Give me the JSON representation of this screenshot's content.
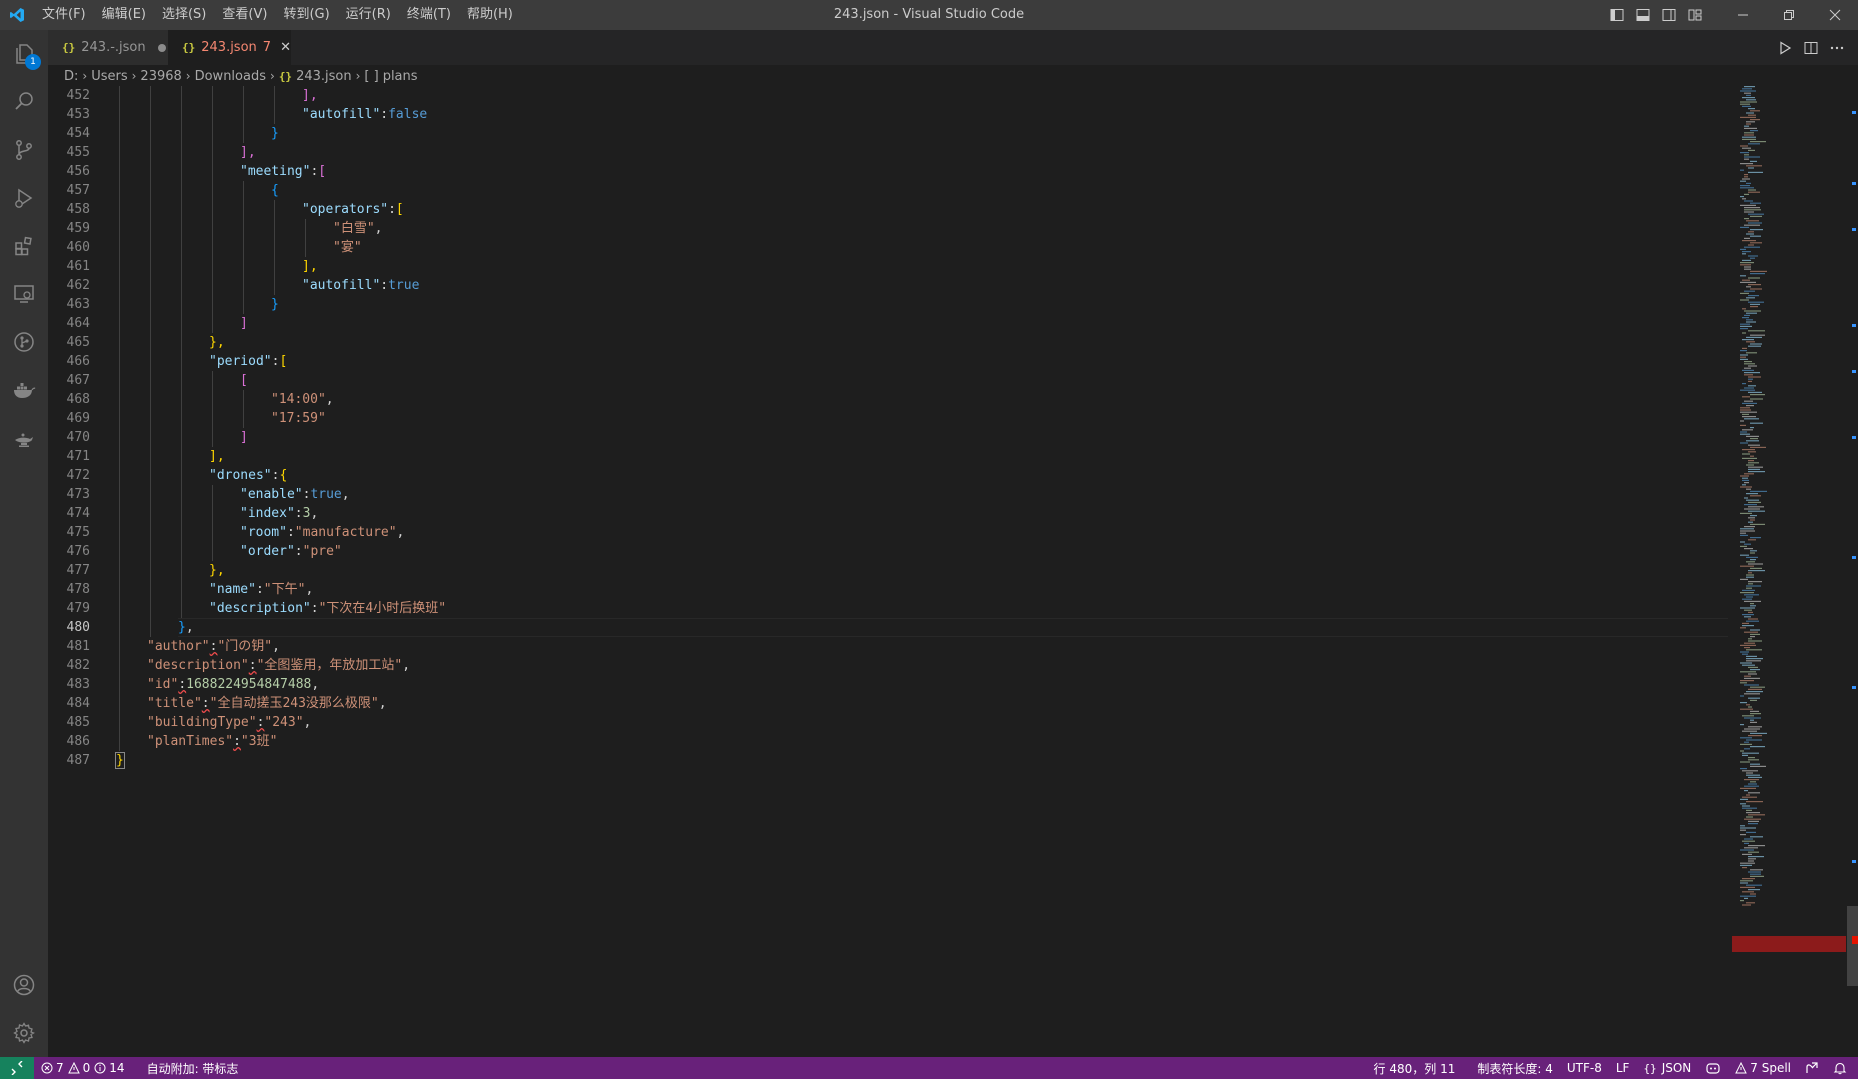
{
  "window": {
    "title": "243.json - Visual Studio Code",
    "menu": [
      "文件(F)",
      "编辑(E)",
      "选择(S)",
      "查看(V)",
      "转到(G)",
      "运行(R)",
      "终端(T)",
      "帮助(H)"
    ]
  },
  "activity_bar": {
    "explorer_badge": "1"
  },
  "tabs": [
    {
      "label": "243.-.json",
      "modified": true
    },
    {
      "label": "243.json",
      "problems": "7",
      "active": true
    }
  ],
  "breadcrumb": [
    "D:",
    "Users",
    "23968",
    "Downloads",
    "243.json",
    "plans"
  ],
  "breadcrumb_last_prefix": "[ ]",
  "editor": {
    "active_line": 480,
    "lines": [
      {
        "n": 452,
        "indent": 6,
        "tokens": [
          [
            "br2",
            "],"
          ]
        ]
      },
      {
        "n": 453,
        "indent": 6,
        "tokens": [
          [
            "k",
            "\"autofill\""
          ],
          [
            "p",
            ":"
          ],
          [
            "b",
            "false"
          ]
        ]
      },
      {
        "n": 454,
        "indent": 5,
        "tokens": [
          [
            "br3",
            "}"
          ]
        ]
      },
      {
        "n": 455,
        "indent": 4,
        "tokens": [
          [
            "br2",
            "],"
          ]
        ]
      },
      {
        "n": 456,
        "indent": 4,
        "tokens": [
          [
            "k",
            "\"meeting\""
          ],
          [
            "p",
            ":"
          ],
          [
            "br2",
            "["
          ]
        ]
      },
      {
        "n": 457,
        "indent": 5,
        "tokens": [
          [
            "br3",
            "{"
          ]
        ]
      },
      {
        "n": 458,
        "indent": 6,
        "tokens": [
          [
            "k",
            "\"operators\""
          ],
          [
            "p",
            ":"
          ],
          [
            "br1",
            "["
          ]
        ]
      },
      {
        "n": 459,
        "indent": 7,
        "tokens": [
          [
            "s",
            "\"白雪\""
          ],
          [
            "p",
            ","
          ]
        ]
      },
      {
        "n": 460,
        "indent": 7,
        "tokens": [
          [
            "s",
            "\"宴\""
          ]
        ]
      },
      {
        "n": 461,
        "indent": 6,
        "tokens": [
          [
            "br1",
            "],"
          ]
        ]
      },
      {
        "n": 462,
        "indent": 6,
        "tokens": [
          [
            "k",
            "\"autofill\""
          ],
          [
            "p",
            ":"
          ],
          [
            "b",
            "true"
          ]
        ]
      },
      {
        "n": 463,
        "indent": 5,
        "tokens": [
          [
            "br3",
            "}"
          ]
        ]
      },
      {
        "n": 464,
        "indent": 4,
        "tokens": [
          [
            "br2",
            "]"
          ]
        ]
      },
      {
        "n": 465,
        "indent": 3,
        "tokens": [
          [
            "br1",
            "},"
          ]
        ]
      },
      {
        "n": 466,
        "indent": 3,
        "tokens": [
          [
            "k",
            "\"period\""
          ],
          [
            "p",
            ":"
          ],
          [
            "br1",
            "["
          ]
        ]
      },
      {
        "n": 467,
        "indent": 4,
        "tokens": [
          [
            "br2",
            "["
          ]
        ]
      },
      {
        "n": 468,
        "indent": 5,
        "tokens": [
          [
            "s",
            "\"14:00\""
          ],
          [
            "p",
            ","
          ]
        ]
      },
      {
        "n": 469,
        "indent": 5,
        "tokens": [
          [
            "s",
            "\"17:59\""
          ]
        ]
      },
      {
        "n": 470,
        "indent": 4,
        "tokens": [
          [
            "br2",
            "]"
          ]
        ]
      },
      {
        "n": 471,
        "indent": 3,
        "tokens": [
          [
            "br1",
            "],"
          ]
        ]
      },
      {
        "n": 472,
        "indent": 3,
        "tokens": [
          [
            "k",
            "\"drones\""
          ],
          [
            "p",
            ":"
          ],
          [
            "br1",
            "{"
          ]
        ]
      },
      {
        "n": 473,
        "indent": 4,
        "tokens": [
          [
            "k",
            "\"enable\""
          ],
          [
            "p",
            ":"
          ],
          [
            "b",
            "true"
          ],
          [
            "p",
            ","
          ]
        ]
      },
      {
        "n": 474,
        "indent": 4,
        "tokens": [
          [
            "k",
            "\"index\""
          ],
          [
            "p",
            ":"
          ],
          [
            "n",
            "3"
          ],
          [
            "p",
            ","
          ]
        ]
      },
      {
        "n": 475,
        "indent": 4,
        "tokens": [
          [
            "k",
            "\"room\""
          ],
          [
            "p",
            ":"
          ],
          [
            "s",
            "\"manufacture\""
          ],
          [
            "p",
            ","
          ]
        ]
      },
      {
        "n": 476,
        "indent": 4,
        "tokens": [
          [
            "k",
            "\"order\""
          ],
          [
            "p",
            ":"
          ],
          [
            "s",
            "\"pre\""
          ]
        ]
      },
      {
        "n": 477,
        "indent": 3,
        "tokens": [
          [
            "br1",
            "},"
          ]
        ]
      },
      {
        "n": 478,
        "indent": 3,
        "tokens": [
          [
            "k",
            "\"name\""
          ],
          [
            "p",
            ":"
          ],
          [
            "s",
            "\"下午\""
          ],
          [
            "p",
            ","
          ]
        ]
      },
      {
        "n": 479,
        "indent": 3,
        "tokens": [
          [
            "k",
            "\"description\""
          ],
          [
            "p",
            ":"
          ],
          [
            "s",
            "\"下次在4小时后换班\""
          ]
        ]
      },
      {
        "n": 480,
        "indent": 2,
        "tokens": [
          [
            "br3",
            "}"
          ],
          [
            "p",
            ","
          ]
        ]
      },
      {
        "n": 481,
        "indent": 1,
        "tokens": [
          [
            "s",
            "\"author\""
          ],
          [
            "perr",
            ":"
          ],
          [
            "s",
            "\"门の钥\""
          ],
          [
            "p",
            ","
          ]
        ]
      },
      {
        "n": 482,
        "indent": 1,
        "tokens": [
          [
            "s",
            "\"description\""
          ],
          [
            "perr",
            ":"
          ],
          [
            "s",
            "\"全图鉴用，年放加工站\""
          ],
          [
            "p",
            ","
          ]
        ]
      },
      {
        "n": 483,
        "indent": 1,
        "tokens": [
          [
            "s",
            "\"id\""
          ],
          [
            "perr",
            ":"
          ],
          [
            "n",
            "1688224954847488"
          ],
          [
            "p",
            ","
          ]
        ]
      },
      {
        "n": 484,
        "indent": 1,
        "tokens": [
          [
            "s",
            "\"title\""
          ],
          [
            "perr",
            ":"
          ],
          [
            "s",
            "\"全自动搓玉243没那么极限\""
          ],
          [
            "p",
            ","
          ]
        ]
      },
      {
        "n": 485,
        "indent": 1,
        "tokens": [
          [
            "s",
            "\"buildingType\""
          ],
          [
            "perr",
            ":"
          ],
          [
            "s",
            "\"243\""
          ],
          [
            "p",
            ","
          ]
        ]
      },
      {
        "n": 486,
        "indent": 1,
        "tokens": [
          [
            "s",
            "\"planTimes\""
          ],
          [
            "perr",
            ":"
          ],
          [
            "s",
            "\"3班\""
          ]
        ]
      },
      {
        "n": 487,
        "indent": 0,
        "tokens": [
          [
            "br1cur",
            "}"
          ]
        ]
      }
    ]
  },
  "statusbar": {
    "errors": "7",
    "warnings": "0",
    "infos": "14",
    "auto_attach": "自动附加: 带标志",
    "position": "行 480，列 11",
    "tab_size": "制表符长度: 4",
    "encoding": "UTF-8",
    "eol": "LF",
    "language": "JSON",
    "spell": "7 Spell"
  }
}
